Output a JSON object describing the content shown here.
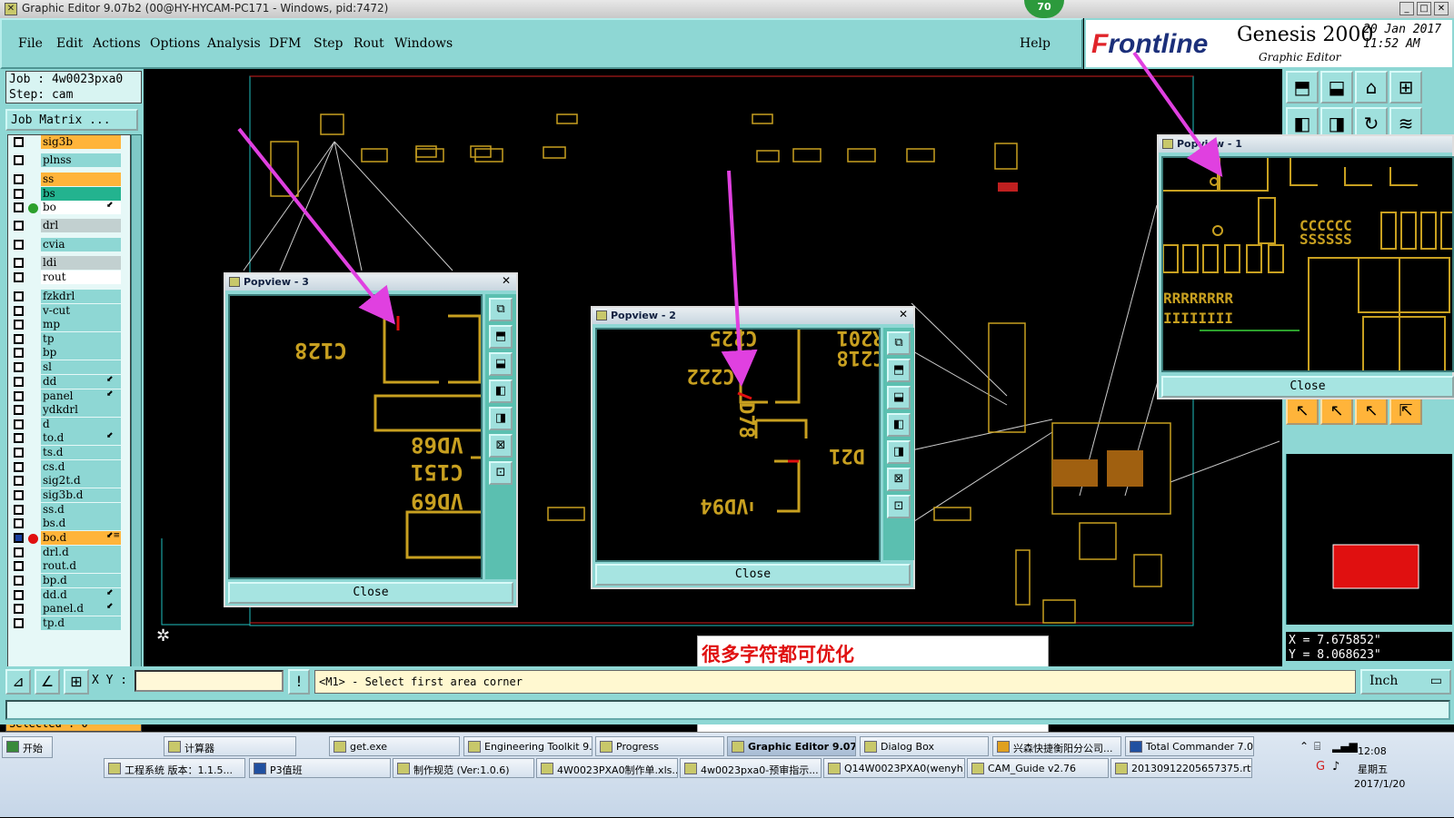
{
  "window": {
    "title": "Graphic Editor 9.07b2 (00@HY-HYCAM-PC171 - Windows, pid:7472)",
    "badge": "70"
  },
  "menu": [
    "File",
    "Edit",
    "Actions",
    "Options",
    "Analysis",
    "DFM",
    "Step",
    "Rout",
    "Windows"
  ],
  "help": "Help",
  "brand": {
    "logo_prefix": "F",
    "logo_rest": "rontline",
    "product": "Genesis 2000",
    "subtitle": "Graphic Editor",
    "date": "20 Jan 2017",
    "time": "11:52 AM"
  },
  "job": {
    "job": "Job  : 4w0023pxa0",
    "step": "Step: cam",
    "matrix_button": "Job Matrix ..."
  },
  "layers": [
    {
      "name": "sig3b",
      "color": "orange"
    },
    {
      "name": "plnss",
      "color": "default"
    },
    {
      "name": "ss",
      "color": "orange"
    },
    {
      "name": "bs",
      "color": "green"
    },
    {
      "name": "bo",
      "color": "white",
      "dot": "#2ca02c",
      "mark": "⬋"
    },
    {
      "name": "drl",
      "color": "gray"
    },
    {
      "name": "cvia",
      "color": "default"
    },
    {
      "name": "ldi",
      "color": "gray"
    },
    {
      "name": "rout",
      "color": "white"
    },
    {
      "name": "fzkdrl",
      "color": "default"
    },
    {
      "name": "v-cut",
      "color": "default"
    },
    {
      "name": "mp",
      "color": "default"
    },
    {
      "name": "tp",
      "color": "default"
    },
    {
      "name": "bp",
      "color": "default"
    },
    {
      "name": "sl",
      "color": "default"
    },
    {
      "name": "dd",
      "color": "default",
      "mark": "⬋"
    },
    {
      "name": "panel",
      "color": "default",
      "mark": "⬋"
    },
    {
      "name": "ydkdrl",
      "color": "default"
    },
    {
      "name": "d",
      "color": "default"
    },
    {
      "name": "to.d",
      "color": "default",
      "mark": "⬋"
    },
    {
      "name": "ts.d",
      "color": "default"
    },
    {
      "name": "cs.d",
      "color": "default"
    },
    {
      "name": "sig2t.d",
      "color": "default"
    },
    {
      "name": "sig3b.d",
      "color": "default"
    },
    {
      "name": "ss.d",
      "color": "default"
    },
    {
      "name": "bs.d",
      "color": "default"
    },
    {
      "name": "bo.d",
      "color": "orangesel",
      "dot": "#e01010",
      "mark": "⬋≡",
      "checked": true
    },
    {
      "name": "drl.d",
      "color": "default"
    },
    {
      "name": "rout.d",
      "color": "default"
    },
    {
      "name": "bp.d",
      "color": "default"
    },
    {
      "name": "dd.d",
      "color": "default",
      "mark": "⬋"
    },
    {
      "name": "panel.d",
      "color": "default",
      "mark": "⬋"
    },
    {
      "name": "tp.d",
      "color": "default"
    }
  ],
  "selected": "Selected : 0",
  "coords": {
    "x": "X = 7.675852\"",
    "y": "Y = 8.068623\""
  },
  "bottom": {
    "xy_label": "X Y :",
    "prompt": "<M1> - Select first area corner",
    "unit": "Inch"
  },
  "note": "很多字符都可优化",
  "popups": [
    {
      "title": "Popview - 3",
      "close": "Close",
      "labels": [
        "C128",
        "VD68",
        "C151",
        "VD69"
      ]
    },
    {
      "title": "Popview - 2",
      "close": "Close",
      "labels": [
        "C225",
        "R201",
        "C218",
        "C222",
        "D78",
        "D21",
        "VD94"
      ]
    },
    {
      "title": "Popview - 1",
      "close": "Close"
    }
  ],
  "taskbar": {
    "start": "开始",
    "row1": [
      "计算器",
      "get.exe",
      "Engineering Toolkit 9....",
      "Progress",
      "Graphic Editor 9.07...",
      "Dialog Box",
      "兴森快捷衡阳分公司...",
      "Total Commander 7.0 ..."
    ],
    "row2": [
      "工程系统  版本：1.1.5...",
      "P3值班",
      "制作规范 (Ver:1.0.6)",
      "4W0023PXA0制作单.xls...",
      "4w0023pxa0-预审指示...",
      "Q14W0023PXA0(wenyh)...",
      "CAM_Guide v2.76",
      "20130912205657375.rtf..."
    ],
    "time": "12:08",
    "weekday": "星期五",
    "date": "2017/1/20"
  },
  "colors": {
    "panel": "#8ed7d4",
    "pad": "#c8a020",
    "selected_layer": "#ffb43a",
    "arrow": "#e040e0"
  }
}
